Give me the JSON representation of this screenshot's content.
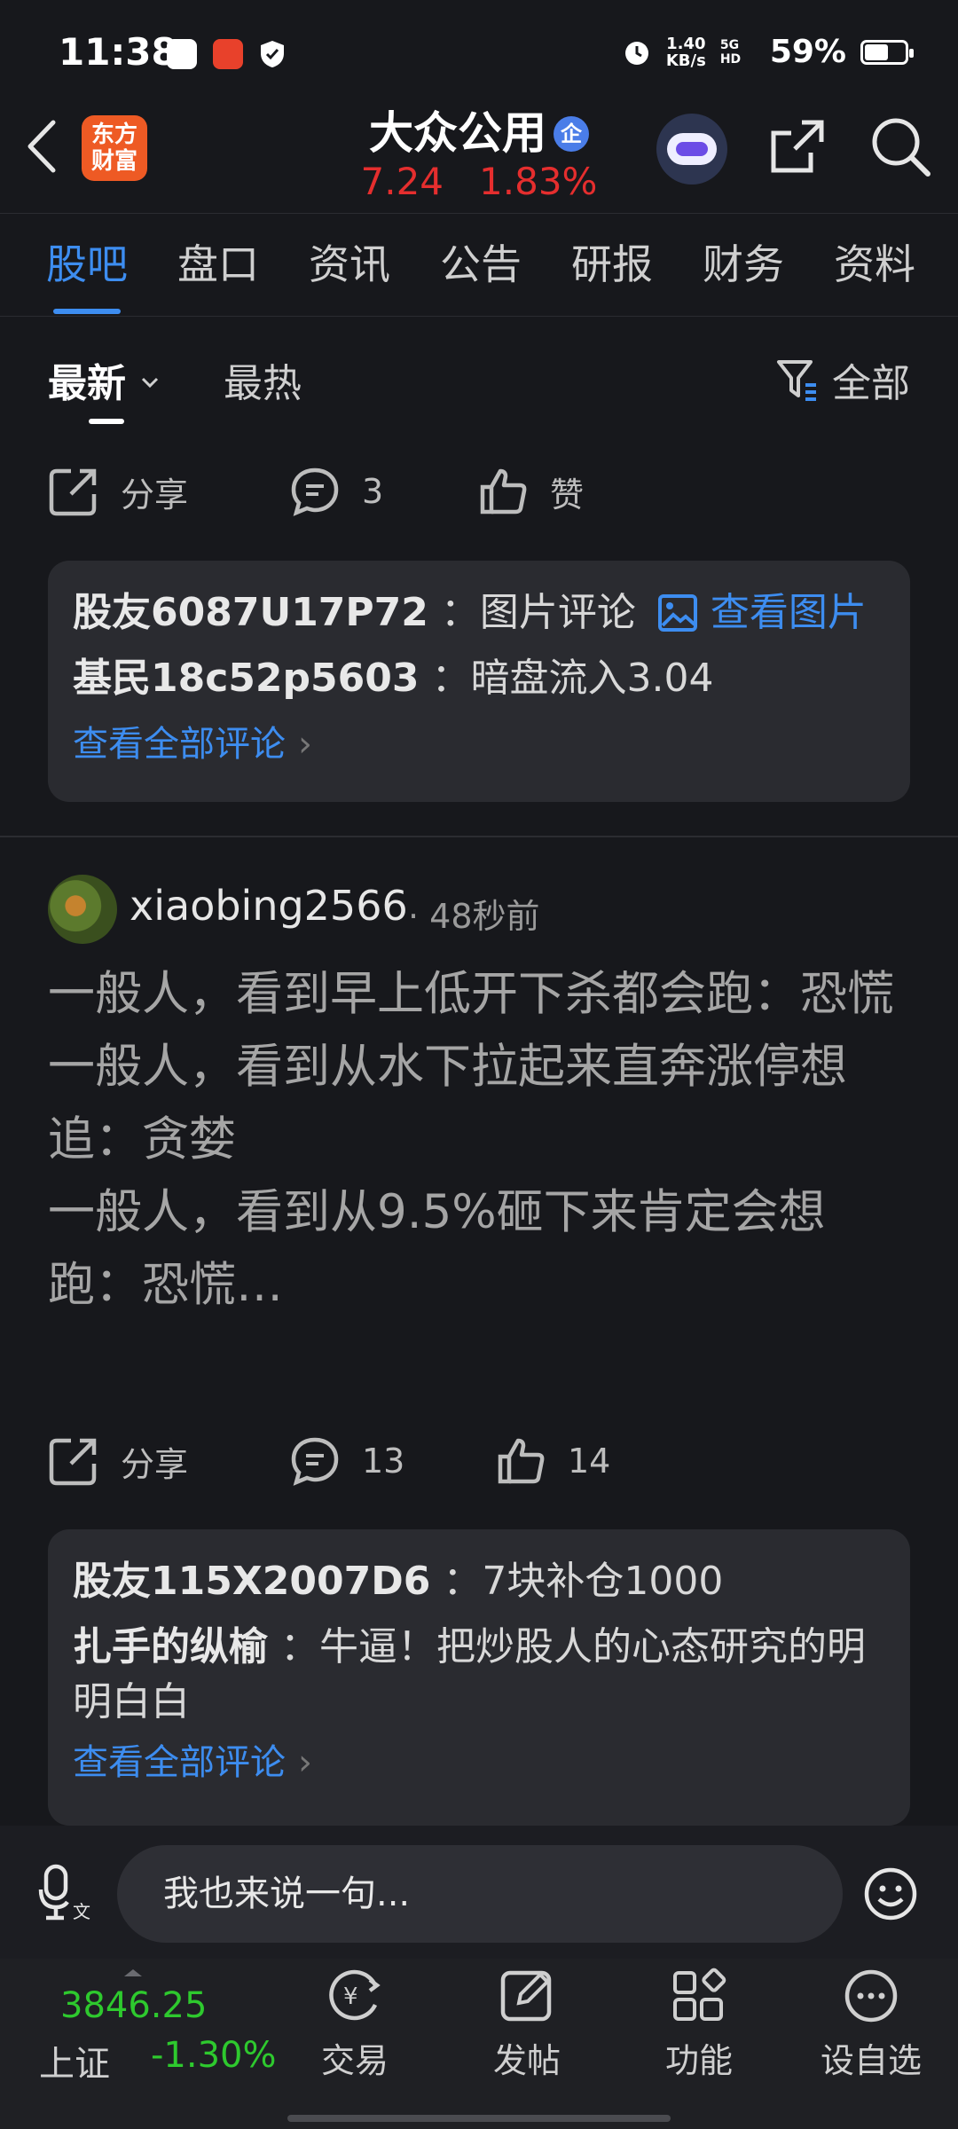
{
  "status_bar": {
    "time": "11:38",
    "netspeed_top": "1.40",
    "netspeed_bottom": "KB/s",
    "network": "5G HD",
    "battery": "59%",
    "battery_level": 0.59
  },
  "header": {
    "logo_line1": "东方",
    "logo_line2": "财富",
    "stock_name": "大众公用",
    "badge": "企",
    "price": "7.24",
    "change": "1.83%"
  },
  "tabs": [
    "股吧",
    "盘口",
    "资讯",
    "公告",
    "研报",
    "财务",
    "资料"
  ],
  "filter": {
    "newest": "最新",
    "hottest": "最热",
    "all": "全部"
  },
  "post1": {
    "share": "分享",
    "comments": "3",
    "like": "赞",
    "replies": [
      {
        "user": "股友6087U17P72",
        "text": "：图片评论",
        "link": "查看图片"
      },
      {
        "user": "基民18c52p5603",
        "text": "：暗盘流入3.04"
      }
    ],
    "see_all": "查看全部评论"
  },
  "post2": {
    "user": "xiaobing2566",
    "time": "· 48秒前",
    "body": "一般人，看到早上低开下杀都会跑：恐慌\n一般人，看到从水下拉起来直奔涨停想追：贪婪\n一般人，看到从9.5%砸下来肯定会想跑：恐慌…",
    "share": "分享",
    "comments": "13",
    "likes": "14",
    "replies": [
      {
        "user": "股友115X2007D6",
        "text": "：7块补仓1000"
      },
      {
        "user": "扎手的纵榆",
        "text": "：牛逼！把炒股人的心态研究的明明白白"
      }
    ],
    "see_all": "查看全部评论"
  },
  "input": {
    "placeholder": "我也来说一句..."
  },
  "bottom_nav": {
    "index_value": "3846.25",
    "index_name": "上证",
    "index_change": "-1.30%",
    "items": [
      "交易",
      "发帖",
      "功能",
      "设自选"
    ]
  }
}
